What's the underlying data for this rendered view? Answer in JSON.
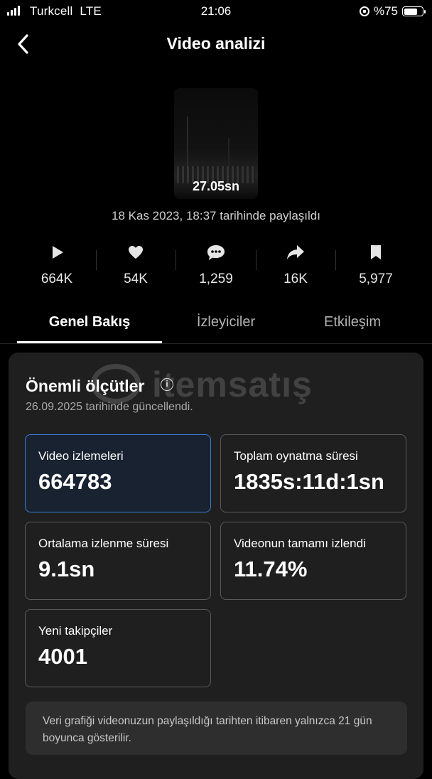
{
  "status_bar": {
    "carrier": "Turkcell",
    "network": "LTE",
    "time": "21:06",
    "battery": "%75",
    "battery_level": 0.75
  },
  "header": {
    "title": "Video analizi",
    "back_icon": "chevron-left-icon"
  },
  "video": {
    "duration": "27.05sn",
    "shared_text": "18 Kas 2023, 18:37 tarihinde paylaşıldı"
  },
  "stats": [
    {
      "icon": "play-icon",
      "value": "664K"
    },
    {
      "icon": "heart-icon",
      "value": "54K"
    },
    {
      "icon": "comment-icon",
      "value": "1,259"
    },
    {
      "icon": "share-icon",
      "value": "16K"
    },
    {
      "icon": "bookmark-icon",
      "value": "5,977"
    }
  ],
  "tabs": [
    "Genel Bakış",
    "İzleyiciler",
    "Etkileşim"
  ],
  "key_metrics": {
    "title": "Önemli ölçütler",
    "updated": "26.09.2025 tarihinde güncellendi.",
    "cards": [
      {
        "label": "Video izlemeleri",
        "value": "664783"
      },
      {
        "label": "Toplam oynatma süresi",
        "value": "1835s:11d:1sn"
      },
      {
        "label": "Ortalama izlenme süresi",
        "value": "9.1sn"
      },
      {
        "label": "Videonun tamamı izlendi",
        "value": "11.74%"
      },
      {
        "label": "Yeni takipçiler",
        "value": "4001"
      }
    ]
  },
  "note": "Veri grafiği videonuzun paylaşıldığı tarihten itibaren yalnızca 21 gün boyunca gösterilir.",
  "watermark": "itemsatış",
  "colors": {
    "background": "#000000",
    "panel": "#1f1f1f",
    "selected_border": "#3b7bd6"
  }
}
